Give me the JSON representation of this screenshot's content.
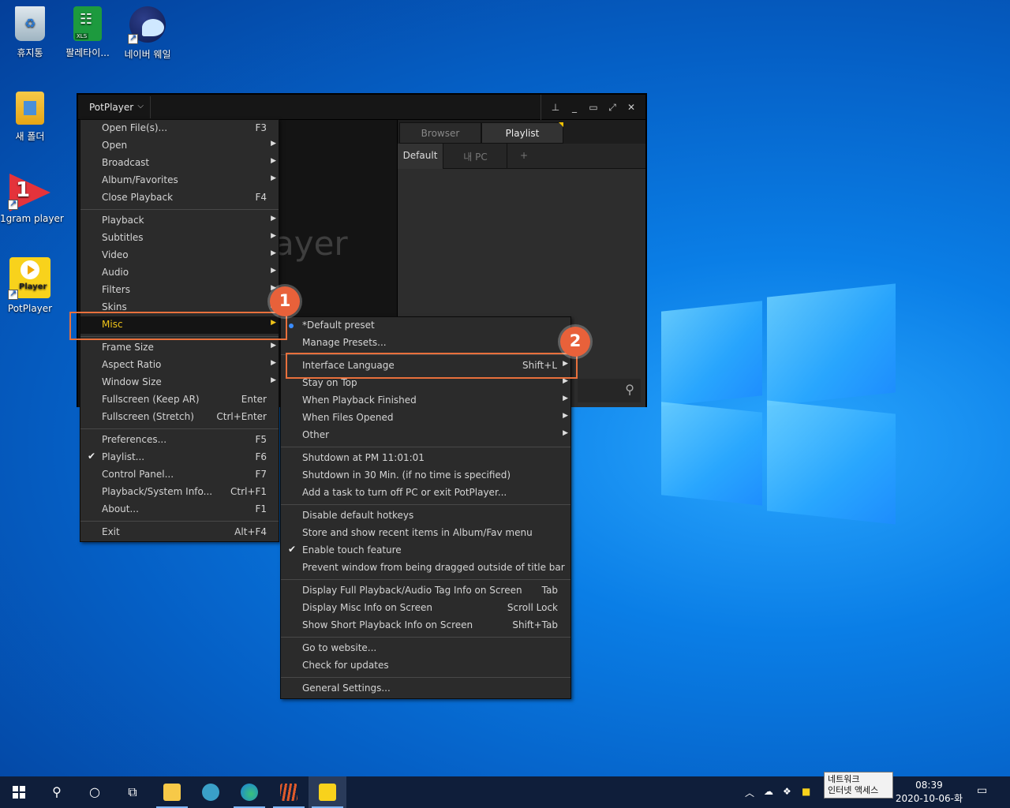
{
  "desktop": {
    "icons": [
      {
        "label": "휴지통",
        "icon": "recycle-bin-icon"
      },
      {
        "label": "팔레타이...",
        "icon": "spreadsheet-icon",
        "badge": "XLS"
      },
      {
        "label": "네이버 웨일",
        "icon": "whale-browser-icon"
      },
      {
        "label": "새 폴더",
        "icon": "folder-icon"
      },
      {
        "label": "1gram player",
        "icon": "media-player-icon"
      },
      {
        "label": "PotPlayer",
        "icon": "potplayer-icon",
        "badge": "Player"
      }
    ]
  },
  "potplayer": {
    "brand": "PotPlayer",
    "video_logo": "ayer",
    "panel_tabs": [
      "Browser",
      "Playlist"
    ],
    "subtabs": [
      "Default",
      "내 PC",
      "+"
    ],
    "title_controls": [
      "pin-icon",
      "minimize-icon",
      "maximize-icon",
      "fullscreen-icon",
      "close-icon"
    ]
  },
  "main_menu": {
    "items": [
      {
        "label": "Open File(s)...",
        "key": "F3"
      },
      {
        "label": "Open",
        "submenu": true
      },
      {
        "label": "Broadcast",
        "submenu": true
      },
      {
        "label": "Album/Favorites",
        "submenu": true
      },
      {
        "label": "Close Playback",
        "key": "F4"
      },
      {
        "label": "Playback",
        "submenu": true
      },
      {
        "label": "Subtitles",
        "submenu": true
      },
      {
        "label": "Video",
        "submenu": true
      },
      {
        "label": "Audio",
        "submenu": true
      },
      {
        "label": "Filters",
        "submenu": true
      },
      {
        "label": "Skins",
        "submenu": true
      },
      {
        "label": "Misc",
        "submenu": true,
        "highlighted": true
      },
      {
        "label": "Frame Size",
        "submenu": true
      },
      {
        "label": "Aspect Ratio",
        "submenu": true
      },
      {
        "label": "Window Size",
        "submenu": true
      },
      {
        "label": "Fullscreen (Keep AR)",
        "key": "Enter"
      },
      {
        "label": "Fullscreen (Stretch)",
        "key": "Ctrl+Enter"
      },
      {
        "label": "Preferences...",
        "key": "F5"
      },
      {
        "label": "Playlist...",
        "key": "F6",
        "checked": true
      },
      {
        "label": "Control Panel...",
        "key": "F7"
      },
      {
        "label": "Playback/System Info...",
        "key": "Ctrl+F1"
      },
      {
        "label": "About...",
        "key": "F1"
      },
      {
        "label": "Exit",
        "key": "Alt+F4"
      }
    ]
  },
  "misc_menu": {
    "items": [
      {
        "label": "*Default preset",
        "radio": true
      },
      {
        "label": "Manage Presets..."
      },
      {
        "label": "Interface Language",
        "key": "Shift+L",
        "submenu": true
      },
      {
        "label": "Stay on Top",
        "submenu": true
      },
      {
        "label": "When Playback Finished",
        "submenu": true
      },
      {
        "label": "When Files Opened",
        "submenu": true
      },
      {
        "label": "Other",
        "submenu": true
      },
      {
        "label": "Shutdown at PM 11:01:01"
      },
      {
        "label": "Shutdown in 30 Min. (if no time is specified)"
      },
      {
        "label": "Add a task to turn off PC or exit PotPlayer..."
      },
      {
        "label": "Disable default hotkeys"
      },
      {
        "label": "Store and show recent items in Album/Fav menu"
      },
      {
        "label": "Enable touch feature",
        "checked": true
      },
      {
        "label": "Prevent window from being dragged outside of title bar"
      },
      {
        "label": "Display Full Playback/Audio Tag Info on Screen",
        "key": "Tab"
      },
      {
        "label": "Display Misc Info on Screen",
        "key": "Scroll Lock"
      },
      {
        "label": "Show Short Playback Info on Screen",
        "key": "Shift+Tab"
      },
      {
        "label": "Go to website..."
      },
      {
        "label": "Check for updates"
      },
      {
        "label": "General Settings..."
      }
    ]
  },
  "callouts": {
    "one": "1",
    "two": "2"
  },
  "taskbar": {
    "apps": [
      "file-explorer-icon",
      "whale-browser-icon",
      "edge-icon",
      "app-icon",
      "potplayer-icon"
    ],
    "tooltip_line1": "네트워크",
    "tooltip_line2": "인터넷 액세스",
    "time": "08:39",
    "date": "2020-10-06-화"
  },
  "colors": {
    "accent": "#f0c419",
    "callout": "#e8703c",
    "menu_bg": "#2b2b2b"
  }
}
